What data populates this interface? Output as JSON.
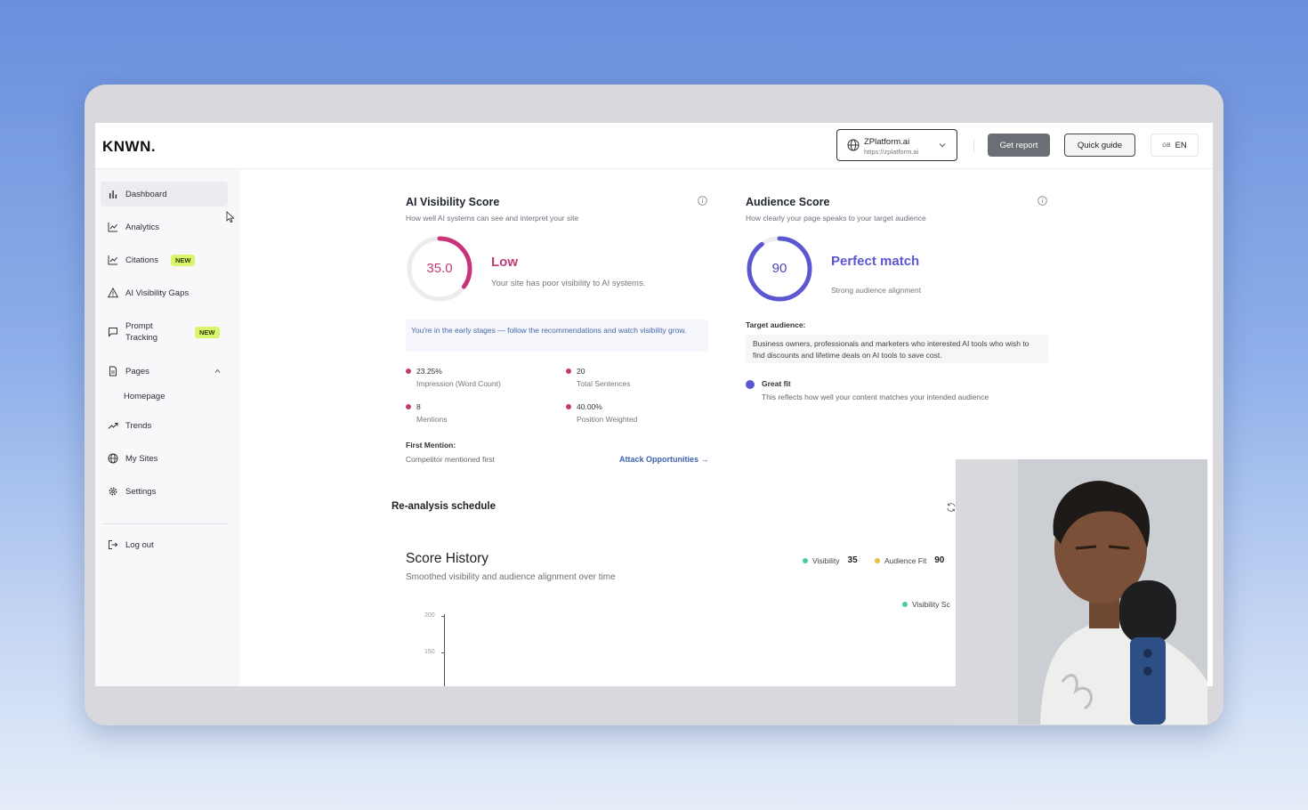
{
  "brand": {
    "logo": "KNWN."
  },
  "header": {
    "site_name": "ZPlatform.ai",
    "site_url": "https://zplatform.ai",
    "get_report": "Get report",
    "quick_guide": "Quick guide",
    "lang_flag": "GB",
    "lang": "EN"
  },
  "sidebar": {
    "items": [
      {
        "label": "Dashboard",
        "icon": "bar-chart-icon"
      },
      {
        "label": "Analytics",
        "icon": "line-chart-icon"
      },
      {
        "label": "Citations",
        "icon": "line-chart-icon",
        "badge": "NEW"
      },
      {
        "label": "AI Visibility Gaps",
        "icon": "warning-triangle-icon"
      },
      {
        "label": "Prompt Tracking",
        "line1": "Prompt",
        "line2": "Tracking",
        "icon": "message-icon",
        "badge": "NEW"
      },
      {
        "label": "Pages",
        "icon": "document-icon"
      },
      {
        "label": "Homepage"
      },
      {
        "label": "Trends",
        "icon": "trend-up-icon"
      },
      {
        "label": "My Sites",
        "icon": "globe-icon"
      },
      {
        "label": "Settings",
        "icon": "gear-icon"
      },
      {
        "label": "Log out",
        "icon": "logout-icon"
      }
    ]
  },
  "visibility": {
    "title": "AI Visibility Score",
    "subtitle": "How well AI systems can see and interpret your site",
    "score": "35.0",
    "score_fraction": 0.35,
    "rating": "Low",
    "rating_desc": "Your site has poor visibility to AI systems.",
    "hint": "You're in the early stages — follow the recommendations and watch visibility grow.",
    "metrics": [
      {
        "value": "23.25%",
        "label": "Impression (Word Count)"
      },
      {
        "value": "20",
        "label": "Total Sentences"
      },
      {
        "value": "8",
        "label": "Mentions"
      },
      {
        "value": "40.00%",
        "label": "Position Weighted"
      }
    ],
    "first_mention_label": "First Mention:",
    "first_mention_value": "Competitor mentioned first",
    "attack_link": "Attack Opportunities →",
    "accent": "#c8347a"
  },
  "audience": {
    "title": "Audience Score",
    "subtitle": "How clearly your page speaks to your target audience",
    "score": "90",
    "score_fraction": 0.9,
    "rating": "Perfect match",
    "rating_desc": "Strong audience alignment",
    "target_label": "Target audience:",
    "target_text": "Business owners, professionals and marketers who interested AI tools who wish to find discounts and lifetime deals on AI tools to save cost.",
    "fit_label": "Great fit",
    "fit_desc": "This reflects how well your content matches your intended audience",
    "accent": "#5b57d1"
  },
  "reanalysis": {
    "title": "Re-analysis schedule"
  },
  "history": {
    "title": "Score History",
    "subtitle": "Smoothed visibility and audience alignment over time",
    "legend": [
      {
        "name": "Visibility",
        "value": "35",
        "color": "#4cc9a3"
      },
      {
        "name": "Audience Fit",
        "value": "90",
        "color": "#e8c13a"
      }
    ],
    "series_label": "Visibility Sc",
    "y_ticks": [
      "200",
      "150"
    ]
  }
}
